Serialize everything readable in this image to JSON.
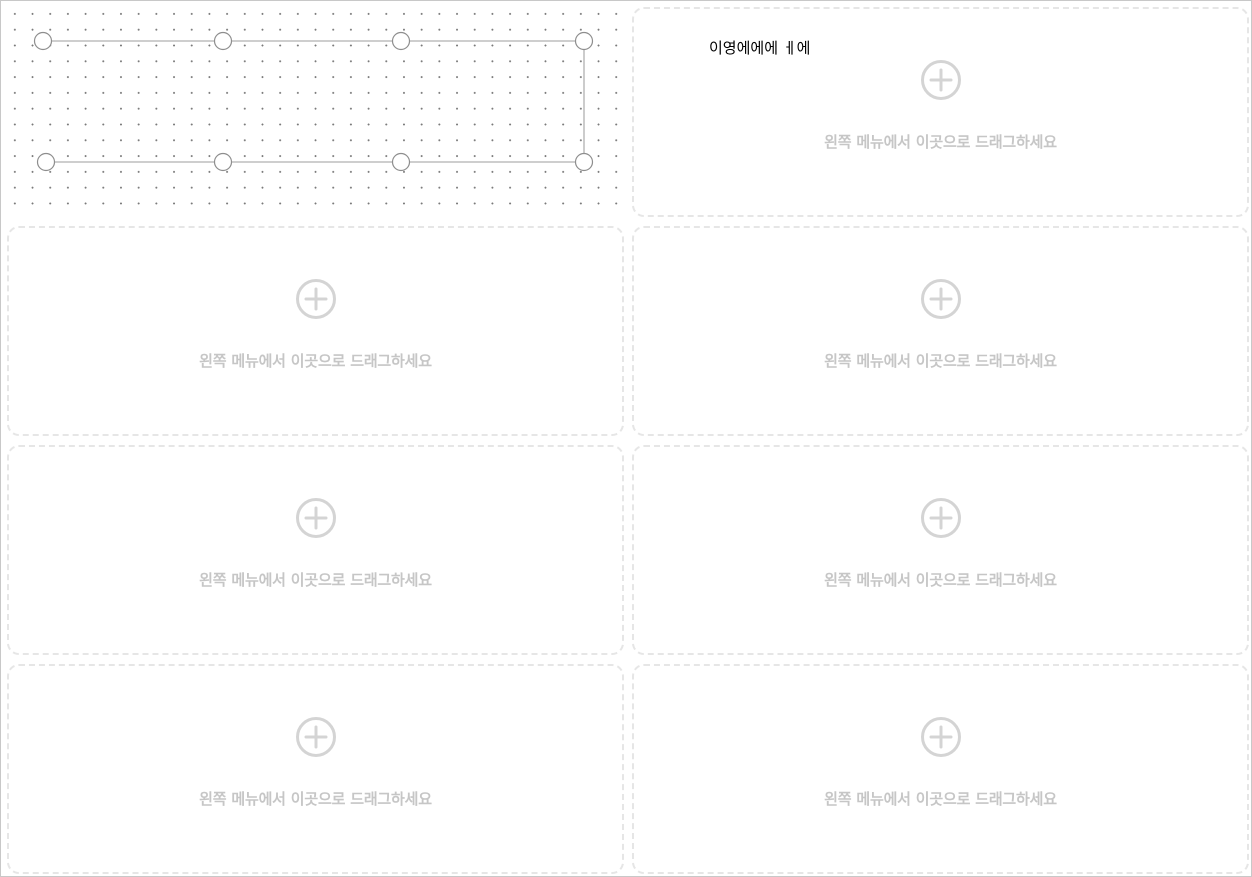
{
  "colors": {
    "slot_border": "#e6e6e6",
    "hint_text": "#c6c6c6",
    "plus_icon": "#d4d4d4",
    "node_stroke": "#8e8e8e",
    "line_stroke": "#b0b0b0",
    "dot_grid": "#7a7a7a"
  },
  "canvas": {
    "nodes_top_row": 4,
    "nodes_bottom_row": 4
  },
  "floating_text": "이영에에에 ㅔ에",
  "slots": [
    {
      "hint": "왼쪽 메뉴에서 이곳으로 드래그하세요",
      "icon": "add-circle-icon"
    },
    {
      "hint": "왼쪽 메뉴에서 이곳으로 드래그하세요",
      "icon": "add-circle-icon"
    },
    {
      "hint": "왼쪽 메뉴에서 이곳으로 드래그하세요",
      "icon": "add-circle-icon"
    },
    {
      "hint": "왼쪽 메뉴에서 이곳으로 드래그하세요",
      "icon": "add-circle-icon"
    },
    {
      "hint": "왼쪽 메뉴에서 이곳으로 드래그하세요",
      "icon": "add-circle-icon"
    },
    {
      "hint": "왼쪽 메뉴에서 이곳으로 드래그하세요",
      "icon": "add-circle-icon"
    },
    {
      "hint": "왼쪽 메뉴에서 이곳으로 드래그하세요",
      "icon": "add-circle-icon"
    }
  ]
}
